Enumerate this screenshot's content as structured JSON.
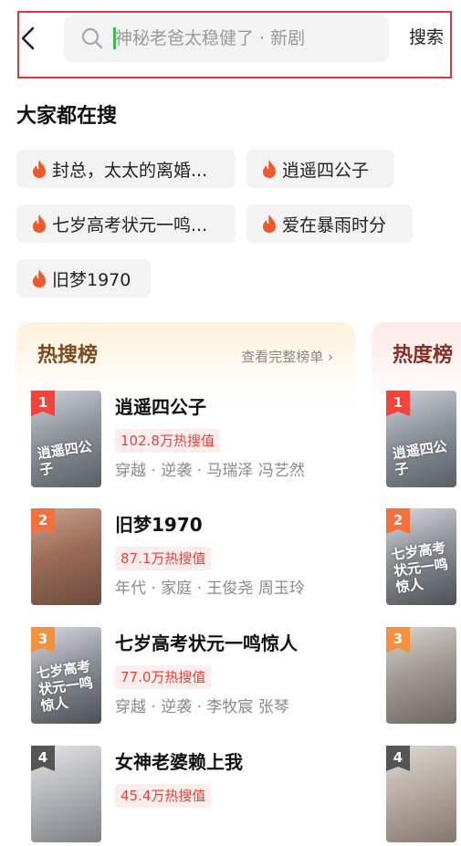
{
  "search": {
    "placeholder": "神秘老爸太稳健了 · 新剧",
    "button_label": "搜索"
  },
  "popular": {
    "title": "大家都在搜",
    "chips": [
      {
        "label": "封总，太太的离婚..."
      },
      {
        "label": "逍遥四公子"
      },
      {
        "label": "七岁高考状元一鸣..."
      },
      {
        "label": "爱在暴雨时分"
      },
      {
        "label": "旧梦1970"
      }
    ]
  },
  "hot_search": {
    "title": "热搜榜",
    "link": "查看完整榜单 ›",
    "items": [
      {
        "rank": "1",
        "title": "逍遥四公子",
        "heat": "102.8万热搜值",
        "tags": "穿越 · 逆袭 · 马瑞泽 冯艺然",
        "poster_text": "逍遥四公子",
        "badge_color": "#f0443c"
      },
      {
        "rank": "2",
        "title": "旧梦1970",
        "heat": "87.1万热搜值",
        "tags": "年代 · 家庭 · 王俊尧 周玉玲",
        "poster_text": "",
        "badge_color": "#f6703d"
      },
      {
        "rank": "3",
        "title": "七岁高考状元一鸣惊人",
        "heat": "77.0万热搜值",
        "tags": "穿越 · 逆袭 · 李牧宸 张琴",
        "poster_text": "七岁高考状元一鸣惊人",
        "badge_color": "#f7903c"
      },
      {
        "rank": "4",
        "title": "女神老婆赖上我",
        "heat": "45.4万热搜值",
        "tags": "",
        "poster_text": "",
        "badge_color": "#555555"
      }
    ]
  },
  "heat_rank": {
    "title": "热度榜",
    "items": [
      {
        "rank": "1",
        "poster_text": "逍遥四公子",
        "badge_color": "#f0443c"
      },
      {
        "rank": "2",
        "poster_text": "七岁高考状元一鸣惊人",
        "badge_color": "#f6703d"
      },
      {
        "rank": "3",
        "poster_text": "",
        "badge_color": "#f7903c"
      },
      {
        "rank": "4",
        "poster_text": "",
        "badge_color": "#555555"
      }
    ]
  },
  "colors": {
    "accent": "#e0363e",
    "flame": "#f05a2a",
    "heat_text": "#e1453d"
  }
}
